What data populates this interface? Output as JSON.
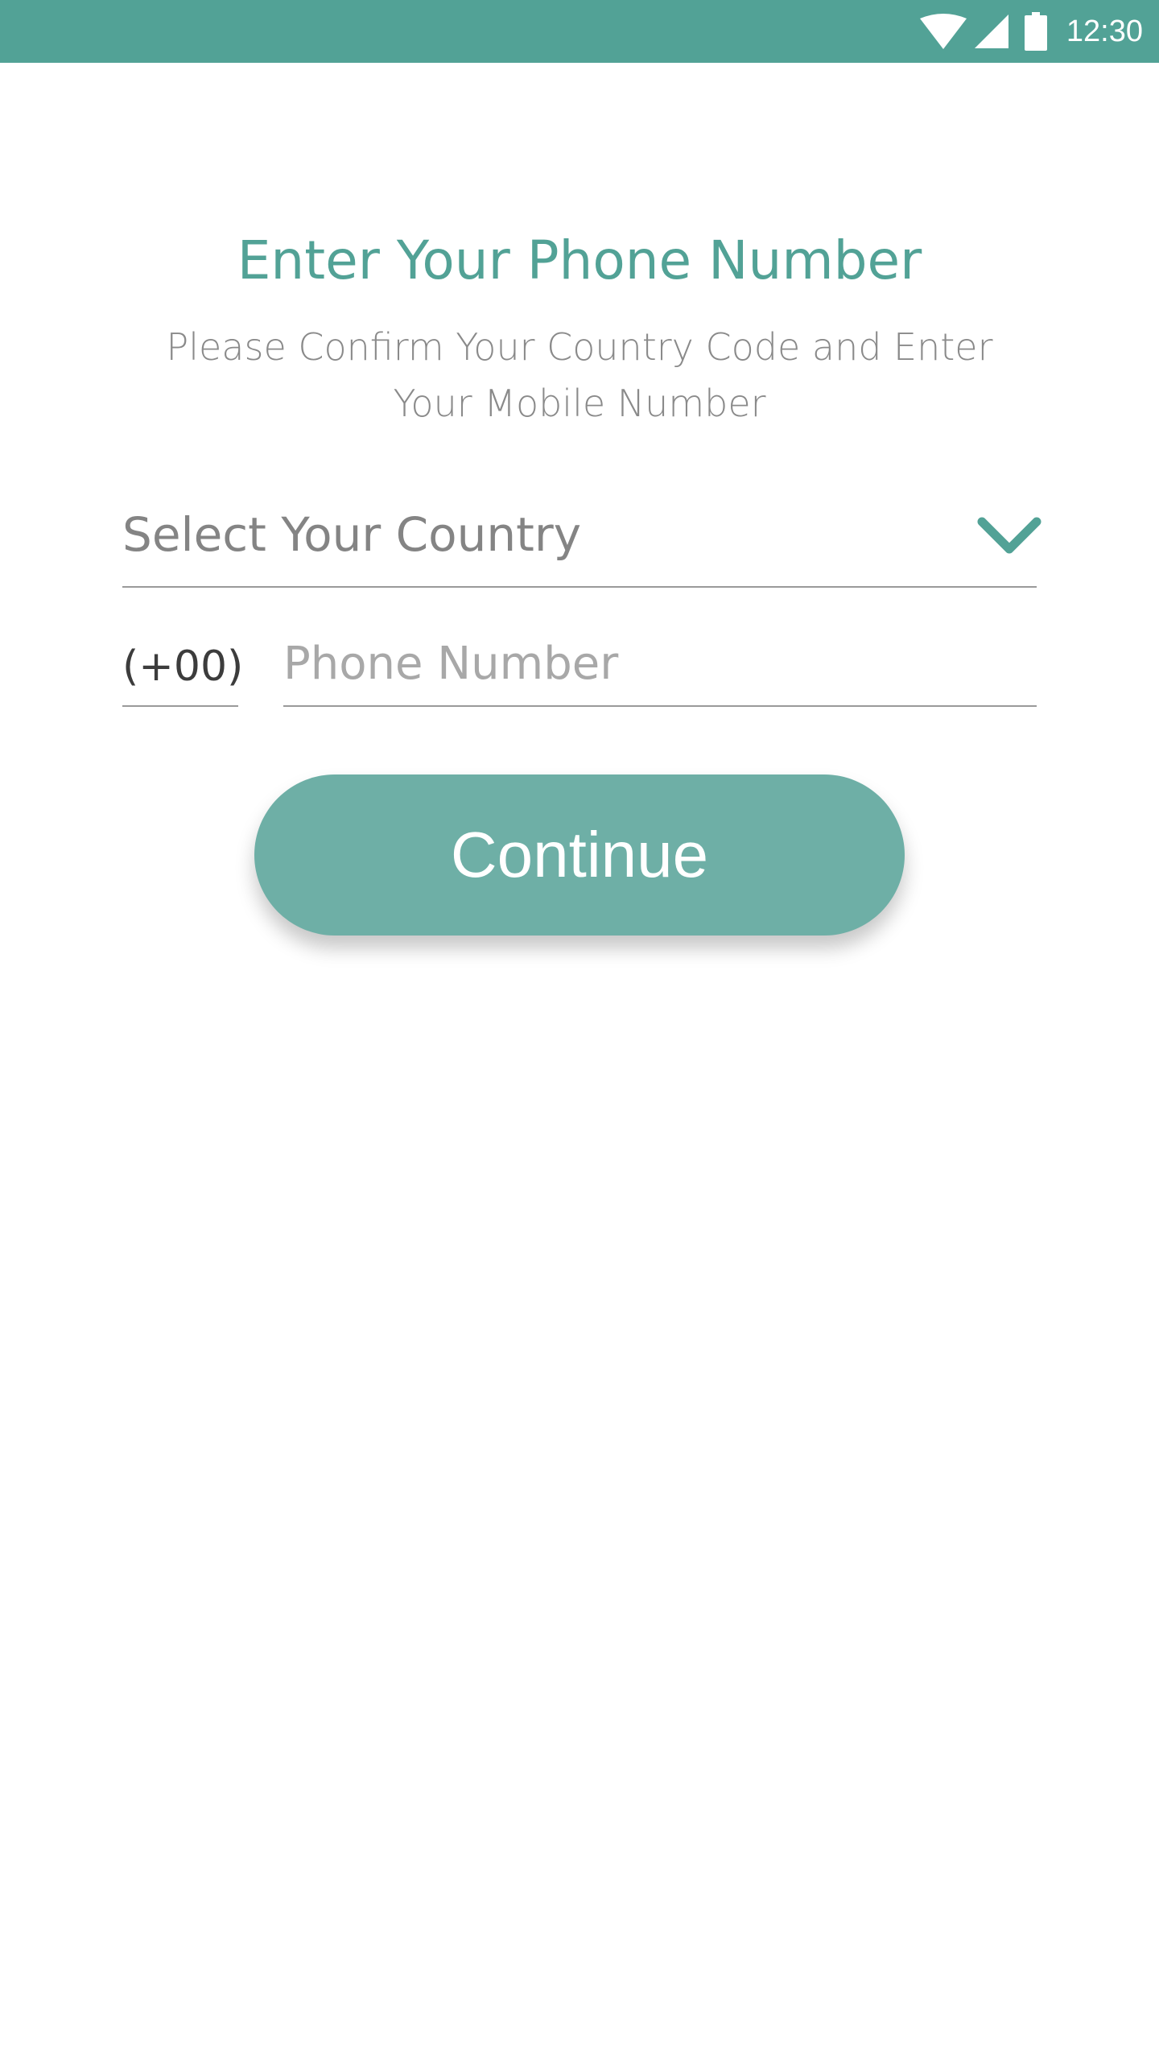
{
  "status_bar": {
    "time": "12:30",
    "icons": [
      "wifi-icon",
      "cell-signal-icon",
      "battery-icon"
    ],
    "background": "#52a296"
  },
  "header": {
    "title": "Enter Your Phone Number",
    "subtitle": "Please Confirm Your Country Code and Enter Your Mobile Number"
  },
  "country_select": {
    "label": "Select Your Country",
    "icon": "chevron-down-icon"
  },
  "phone": {
    "country_code": "(+00)",
    "placeholder": "Phone Number",
    "value": ""
  },
  "actions": {
    "continue_label": "Continue"
  },
  "colors": {
    "accent": "#52a296",
    "button": "#6eafa6",
    "muted_text": "#8a8a8a"
  }
}
